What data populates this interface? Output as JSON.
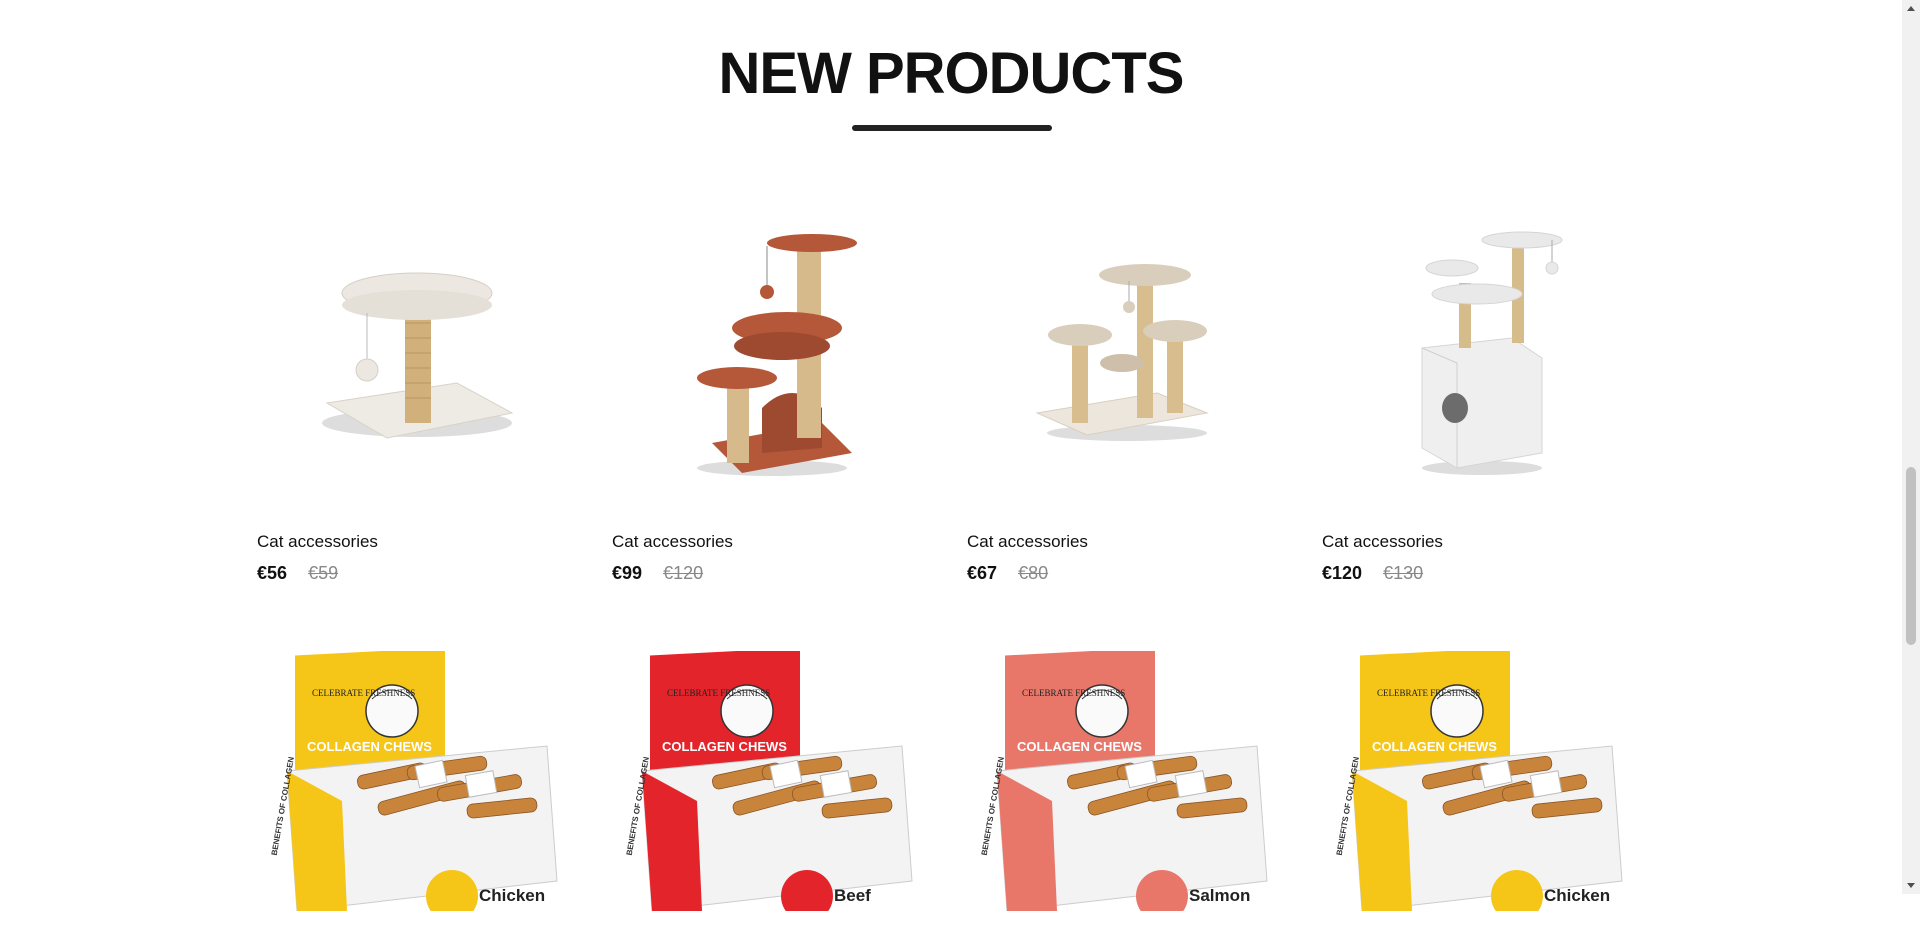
{
  "section": {
    "title": "NEW PRODUCTS"
  },
  "products_row1": [
    {
      "name": "Cat accessories",
      "price": "€56",
      "old_price": "€59",
      "image": "cat-tree-white-round-bed"
    },
    {
      "name": "Cat accessories",
      "price": "€99",
      "old_price": "€120",
      "image": "cat-tree-brown-multilevel"
    },
    {
      "name": "Cat accessories",
      "price": "€67",
      "old_price": "€80",
      "image": "cat-tree-beige-three-platforms"
    },
    {
      "name": "Cat accessories",
      "price": "€120",
      "old_price": "€130",
      "image": "cat-tree-white-with-cube"
    }
  ],
  "products_row2": [
    {
      "image": "collagen-chews-box",
      "brand": "CELEBRATE FRESHNESS",
      "product": "COLLAGEN CHEWS",
      "side": "BENEFITS OF COLLAGEN",
      "flavor": "Chicken",
      "color": "#f5c518"
    },
    {
      "image": "collagen-chews-box",
      "brand": "CELEBRATE FRESHNESS",
      "product": "COLLAGEN CHEWS",
      "side": "BENEFITS OF COLLAGEN",
      "flavor": "Beef",
      "color": "#e3242b"
    },
    {
      "image": "collagen-chews-box",
      "brand": "CELEBRATE FRESHNESS",
      "product": "COLLAGEN CHEWS",
      "side": "BENEFITS OF COLLAGEN",
      "flavor": "Salmon",
      "color": "#e8776a"
    },
    {
      "image": "collagen-chews-box",
      "brand": "CELEBRATE FRESHNESS",
      "product": "COLLAGEN CHEWS",
      "side": "BENEFITS OF COLLAGEN",
      "flavor": "Chicken",
      "color": "#f5c518"
    }
  ]
}
